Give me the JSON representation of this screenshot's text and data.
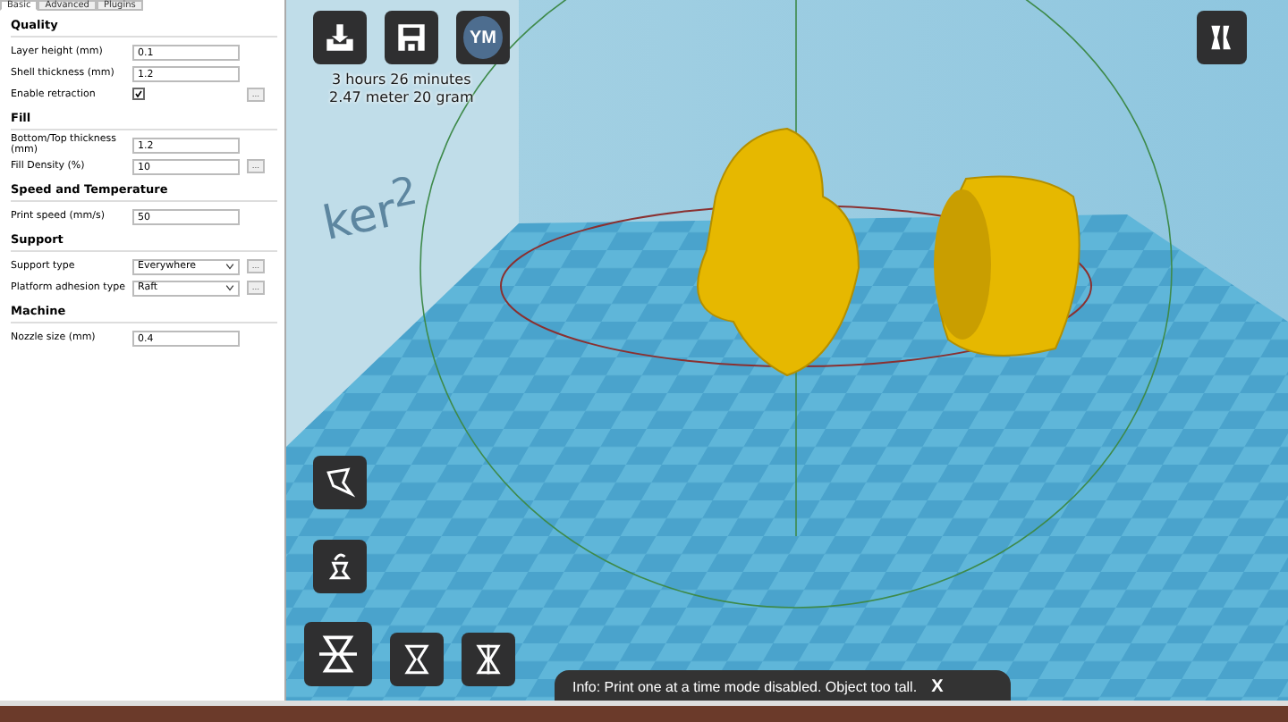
{
  "settings_panel": {
    "tabs": [
      {
        "label": "Basic",
        "selected": true
      },
      {
        "label": "Advanced",
        "selected": false
      },
      {
        "label": "Plugins",
        "selected": false
      }
    ],
    "sections": [
      {
        "title": "Quality",
        "rows": [
          {
            "kind": "text",
            "label": "Layer height (mm)",
            "value": "0.1"
          },
          {
            "kind": "text",
            "label": "Shell thickness (mm)",
            "value": "1.2"
          },
          {
            "kind": "checkbox",
            "label": "Enable retraction",
            "checked": true,
            "extra": "..."
          }
        ]
      },
      {
        "title": "Fill",
        "rows": [
          {
            "kind": "text",
            "label": "Bottom/Top thickness (mm)",
            "value": "1.2"
          },
          {
            "kind": "text",
            "label": "Fill Density (%)",
            "value": "10",
            "extra": "..."
          }
        ]
      },
      {
        "title": "Speed and Temperature",
        "rows": [
          {
            "kind": "text",
            "label": "Print speed (mm/s)",
            "value": "50"
          }
        ]
      },
      {
        "title": "Support",
        "rows": [
          {
            "kind": "select",
            "label": "Support type",
            "value": "Everywhere",
            "extra": "..."
          },
          {
            "kind": "select",
            "label": "Platform adhesion type",
            "value": "Raft",
            "extra": "..."
          }
        ]
      },
      {
        "title": "Machine",
        "rows": [
          {
            "kind": "text",
            "label": "Nozzle size (mm)",
            "value": "0.4"
          }
        ]
      }
    ]
  },
  "viewport": {
    "wall_text": "ker$^{2}$",
    "toolbar": {
      "profile_initials": "YM",
      "print_time": "3 hours 26 minutes",
      "material": "2.47 meter 20 gram"
    },
    "info_bar": {
      "message": "Info: Print one at a time mode disabled. Object too tall.",
      "close": "X"
    }
  }
}
